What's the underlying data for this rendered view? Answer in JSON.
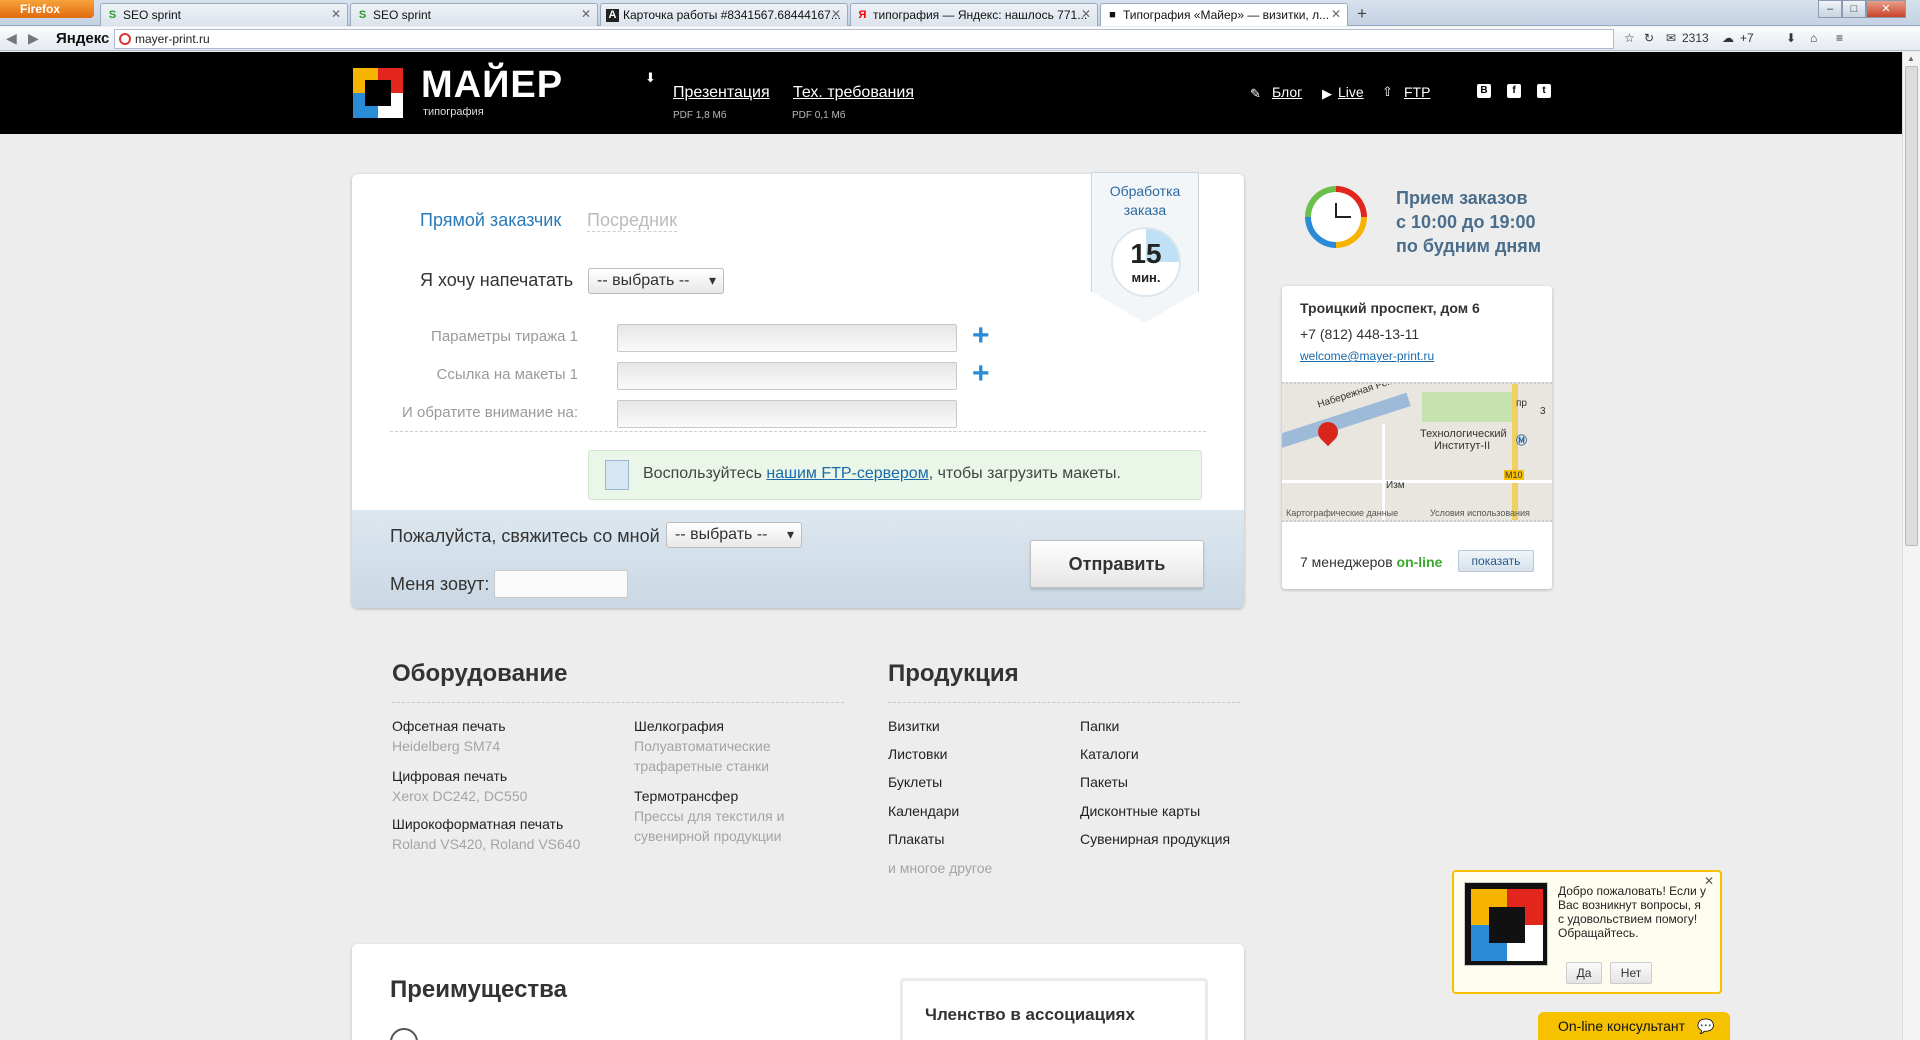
{
  "browser": {
    "menu_label": "Firefox",
    "tabs": [
      {
        "label": "SEO sprint",
        "fav": "S"
      },
      {
        "label": "SEO sprint",
        "fav": "S"
      },
      {
        "label": "Карточка работы #8341567.68444167...",
        "fav": "A"
      },
      {
        "label": "типография — Яндекс: нашлось 771...",
        "fav": "Я"
      },
      {
        "label": "Типография «Майер» — визитки, л...",
        "fav": "■"
      }
    ],
    "yandex_logo": "Яндекс",
    "url": "mayer-print.ru",
    "mail_count": "2313",
    "weather": "+7"
  },
  "header": {
    "logo_title": "МАЙЕР",
    "logo_sub": "типография",
    "links": [
      {
        "label": "Презентация",
        "sub": "PDF 1,8 Мб"
      },
      {
        "label": "Тех. требования",
        "sub": "PDF 0,1 Мб"
      }
    ],
    "right_links": [
      "Блог",
      "Live",
      "FTP"
    ],
    "social": [
      "В",
      "f",
      "t"
    ]
  },
  "form": {
    "tabs": [
      "Прямой заказчик",
      "Посредник"
    ],
    "print_label": "Я хочу напечатать",
    "print_select": "-- выбрать --",
    "fields": [
      "Параметры тиража 1",
      "Ссылка на макеты 1",
      "И обратите внимание на:"
    ],
    "ftp_before": "Воспользуйтесь ",
    "ftp_link": "нашим FTP-сервером",
    "ftp_after": ", чтобы загрузить макеты.",
    "contact_label": "Пожалуйста, свяжитесь со мной",
    "contact_select": "-- выбрать --",
    "name_label": "Меня зовут:",
    "submit": "Отправить"
  },
  "badge": {
    "title_1": "Обработка",
    "title_2": "заказа",
    "value": "15",
    "unit": "мин."
  },
  "hours": {
    "line1": "Прием заказов",
    "line2": "с 10:00 до 19:00",
    "line3": "по будним дням"
  },
  "contact": {
    "address": "Троицкий проспект, дом 6",
    "phone": "+7 (812) 448-13-11",
    "email": "welcome@mayer-print.ru",
    "map_street": "Набережная Рек",
    "map_station_1": "Технологический",
    "map_station_2": "Институт-II",
    "map_izm": "Изм",
    "map_m10": "M10",
    "map_pr": "пр",
    "map_3": "3",
    "map_foot_1": "Картографические данные",
    "map_foot_2": "Условия использования",
    "managers_count": "7 менеджеров",
    "managers_status": "on-line",
    "show_btn": "показать"
  },
  "equipment": {
    "title": "Оборудование",
    "col1": [
      {
        "name": "Офсетная печать",
        "sub": "Heidelberg SM74"
      },
      {
        "name": "Цифровая печать",
        "sub": "Xerox DC242, DC550"
      },
      {
        "name": "Широкоформатная печать",
        "sub": "Roland VS420, Roland VS640"
      }
    ],
    "col2": [
      {
        "name": "Шелкография",
        "sub1": "Полуавтоматические",
        "sub2": "трафаретные станки"
      },
      {
        "name": "Термотрансфер",
        "sub1": "Прессы для текстиля и",
        "sub2": "сувенирной продукции"
      }
    ]
  },
  "products": {
    "title": "Продукция",
    "col1": [
      "Визитки",
      "Листовки",
      "Буклеты",
      "Календари",
      "Плакаты"
    ],
    "more": "и многое другое",
    "col2": [
      "Папки",
      "Каталоги",
      "Пакеты",
      "Дисконтные карты",
      "Сувенирная продукция"
    ]
  },
  "advantages": {
    "title": "Преимущества",
    "membership": "Членство в ассоциациях"
  },
  "chat": {
    "text": "Добро пожаловать! Если у Вас возникнут вопросы, я с удовольствием помогу! Обращайтесь.",
    "yes": "Да",
    "no": "Нет",
    "consultant": "On-line консультант"
  }
}
